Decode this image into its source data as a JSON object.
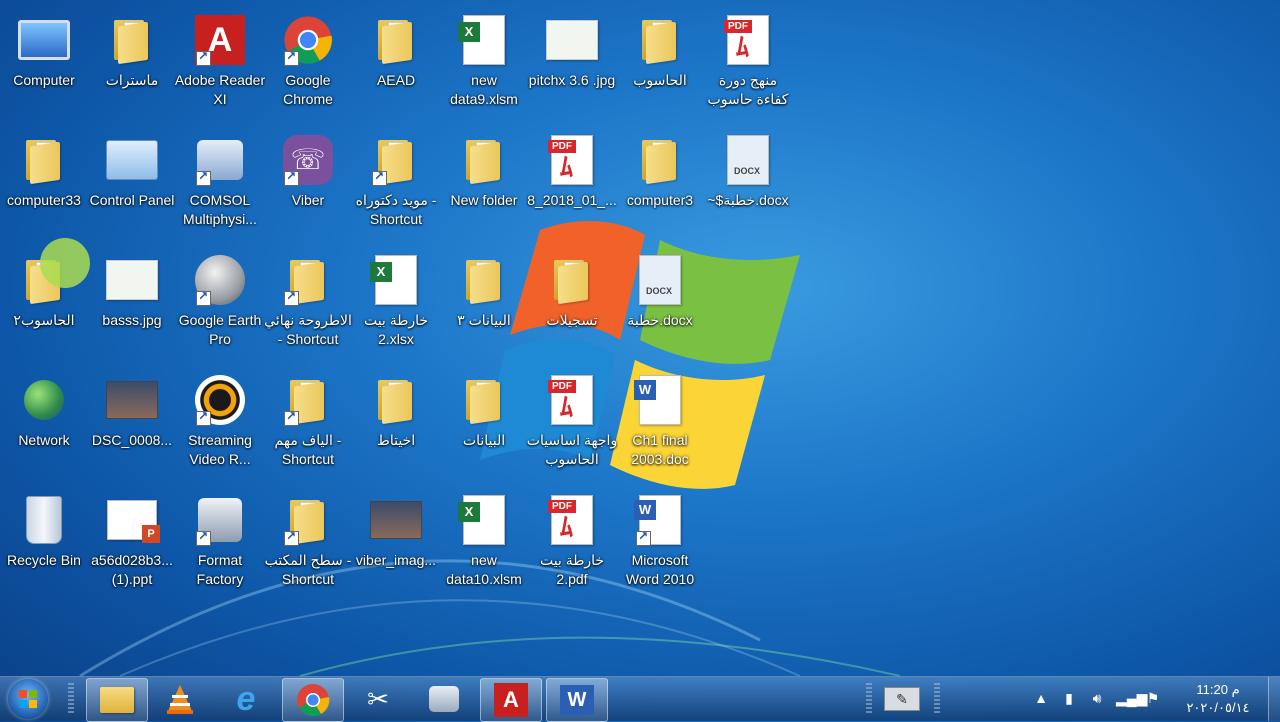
{
  "desktop": {
    "icons": [
      {
        "label": "Computer",
        "icon": "computer-icon"
      },
      {
        "label": "ماسترات",
        "icon": "folder-icon"
      },
      {
        "label": "Adobe Reader XI",
        "icon": "adobe-reader-icon"
      },
      {
        "label": "Google Chrome",
        "icon": "chrome-icon"
      },
      {
        "label": "AEAD",
        "icon": "user-folder-icon"
      },
      {
        "label": "new data9.xlsm",
        "icon": "excel-file-icon"
      },
      {
        "label": "pitchx 3.6 .jpg",
        "icon": "image-file-icon"
      },
      {
        "label": "الحاسوب",
        "icon": "folder-icon"
      },
      {
        "label": "منهج دورة كفاءة حاسوب",
        "icon": "pdf-file-icon"
      },
      {
        "label": "computer33",
        "icon": "folder-icon"
      },
      {
        "label": "Control Panel",
        "icon": "control-panel-icon"
      },
      {
        "label": "COMSOL Multiphysi...",
        "icon": "comsol-icon"
      },
      {
        "label": "Viber",
        "icon": "viber-icon"
      },
      {
        "label": "مويد دكتوراه - Shortcut",
        "icon": "folder-shortcut-icon"
      },
      {
        "label": "New folder",
        "icon": "folder-icon"
      },
      {
        "label": "8_2018_01_...",
        "icon": "pdf-file-icon"
      },
      {
        "label": "computer3",
        "icon": "folder-icon"
      },
      {
        "label": "~$خطبة.docx",
        "icon": "docx-file-icon"
      },
      {
        "label": "الحاسوب٢",
        "icon": "folder-icon"
      },
      {
        "label": "basss.jpg",
        "icon": "image-file-icon"
      },
      {
        "label": "Google Earth Pro",
        "icon": "google-earth-icon"
      },
      {
        "label": "الاطروحة نهائي - Shortcut",
        "icon": "folder-shortcut-icon"
      },
      {
        "label": "خارطة بيت 2.xlsx",
        "icon": "excel-file-icon"
      },
      {
        "label": "البيانات ٣",
        "icon": "folder-icon"
      },
      {
        "label": "تسجيلات",
        "icon": "folder-icon"
      },
      {
        "label": "خطبة.docx",
        "icon": "docx-file-icon"
      },
      {
        "label": "Network",
        "icon": "network-icon"
      },
      {
        "label": "DSC_0008...",
        "icon": "photo-file-icon"
      },
      {
        "label": "Streaming Video R...",
        "icon": "streaming-video-icon"
      },
      {
        "label": "الياف مهم - Shortcut",
        "icon": "folder-shortcut-icon"
      },
      {
        "label": "اخيتاط",
        "icon": "folder-icon"
      },
      {
        "label": "البيانات",
        "icon": "folder-icon"
      },
      {
        "label": "واجهة اساسيات الحاسوب وتط...",
        "icon": "pdf-file-icon"
      },
      {
        "label": "Ch1 final 2003.doc",
        "icon": "word-file-icon"
      },
      {
        "label": "Recycle Bin",
        "icon": "recycle-bin-icon"
      },
      {
        "label": "a56d028b3... (1).ppt",
        "icon": "powerpoint-file-icon"
      },
      {
        "label": "Format Factory",
        "icon": "format-factory-icon"
      },
      {
        "label": "سطح المكتب - Shortcut",
        "icon": "folder-shortcut-icon"
      },
      {
        "label": "viber_imag...",
        "icon": "photo-file-icon"
      },
      {
        "label": "new data10.xlsm",
        "icon": "excel-file-icon"
      },
      {
        "label": "خارطة بيت 2.pdf",
        "icon": "pdf-file-icon"
      },
      {
        "label": "Microsoft Word 2010",
        "icon": "word-shortcut-icon"
      }
    ]
  },
  "taskbar": {
    "pinned": [
      {
        "name": "file-explorer-icon",
        "active": true
      },
      {
        "name": "vlc-icon",
        "active": false
      },
      {
        "name": "internet-explorer-icon",
        "active": false
      },
      {
        "name": "chrome-icon",
        "active": true
      },
      {
        "name": "snipping-tool-icon",
        "active": false
      },
      {
        "name": "format-factory-icon",
        "active": false
      },
      {
        "name": "adobe-reader-icon",
        "active": true
      },
      {
        "name": "word-icon",
        "active": true
      }
    ],
    "clock": {
      "time": "11:20 م",
      "date": "٢٠٢٠/٠٥/١٤"
    }
  }
}
